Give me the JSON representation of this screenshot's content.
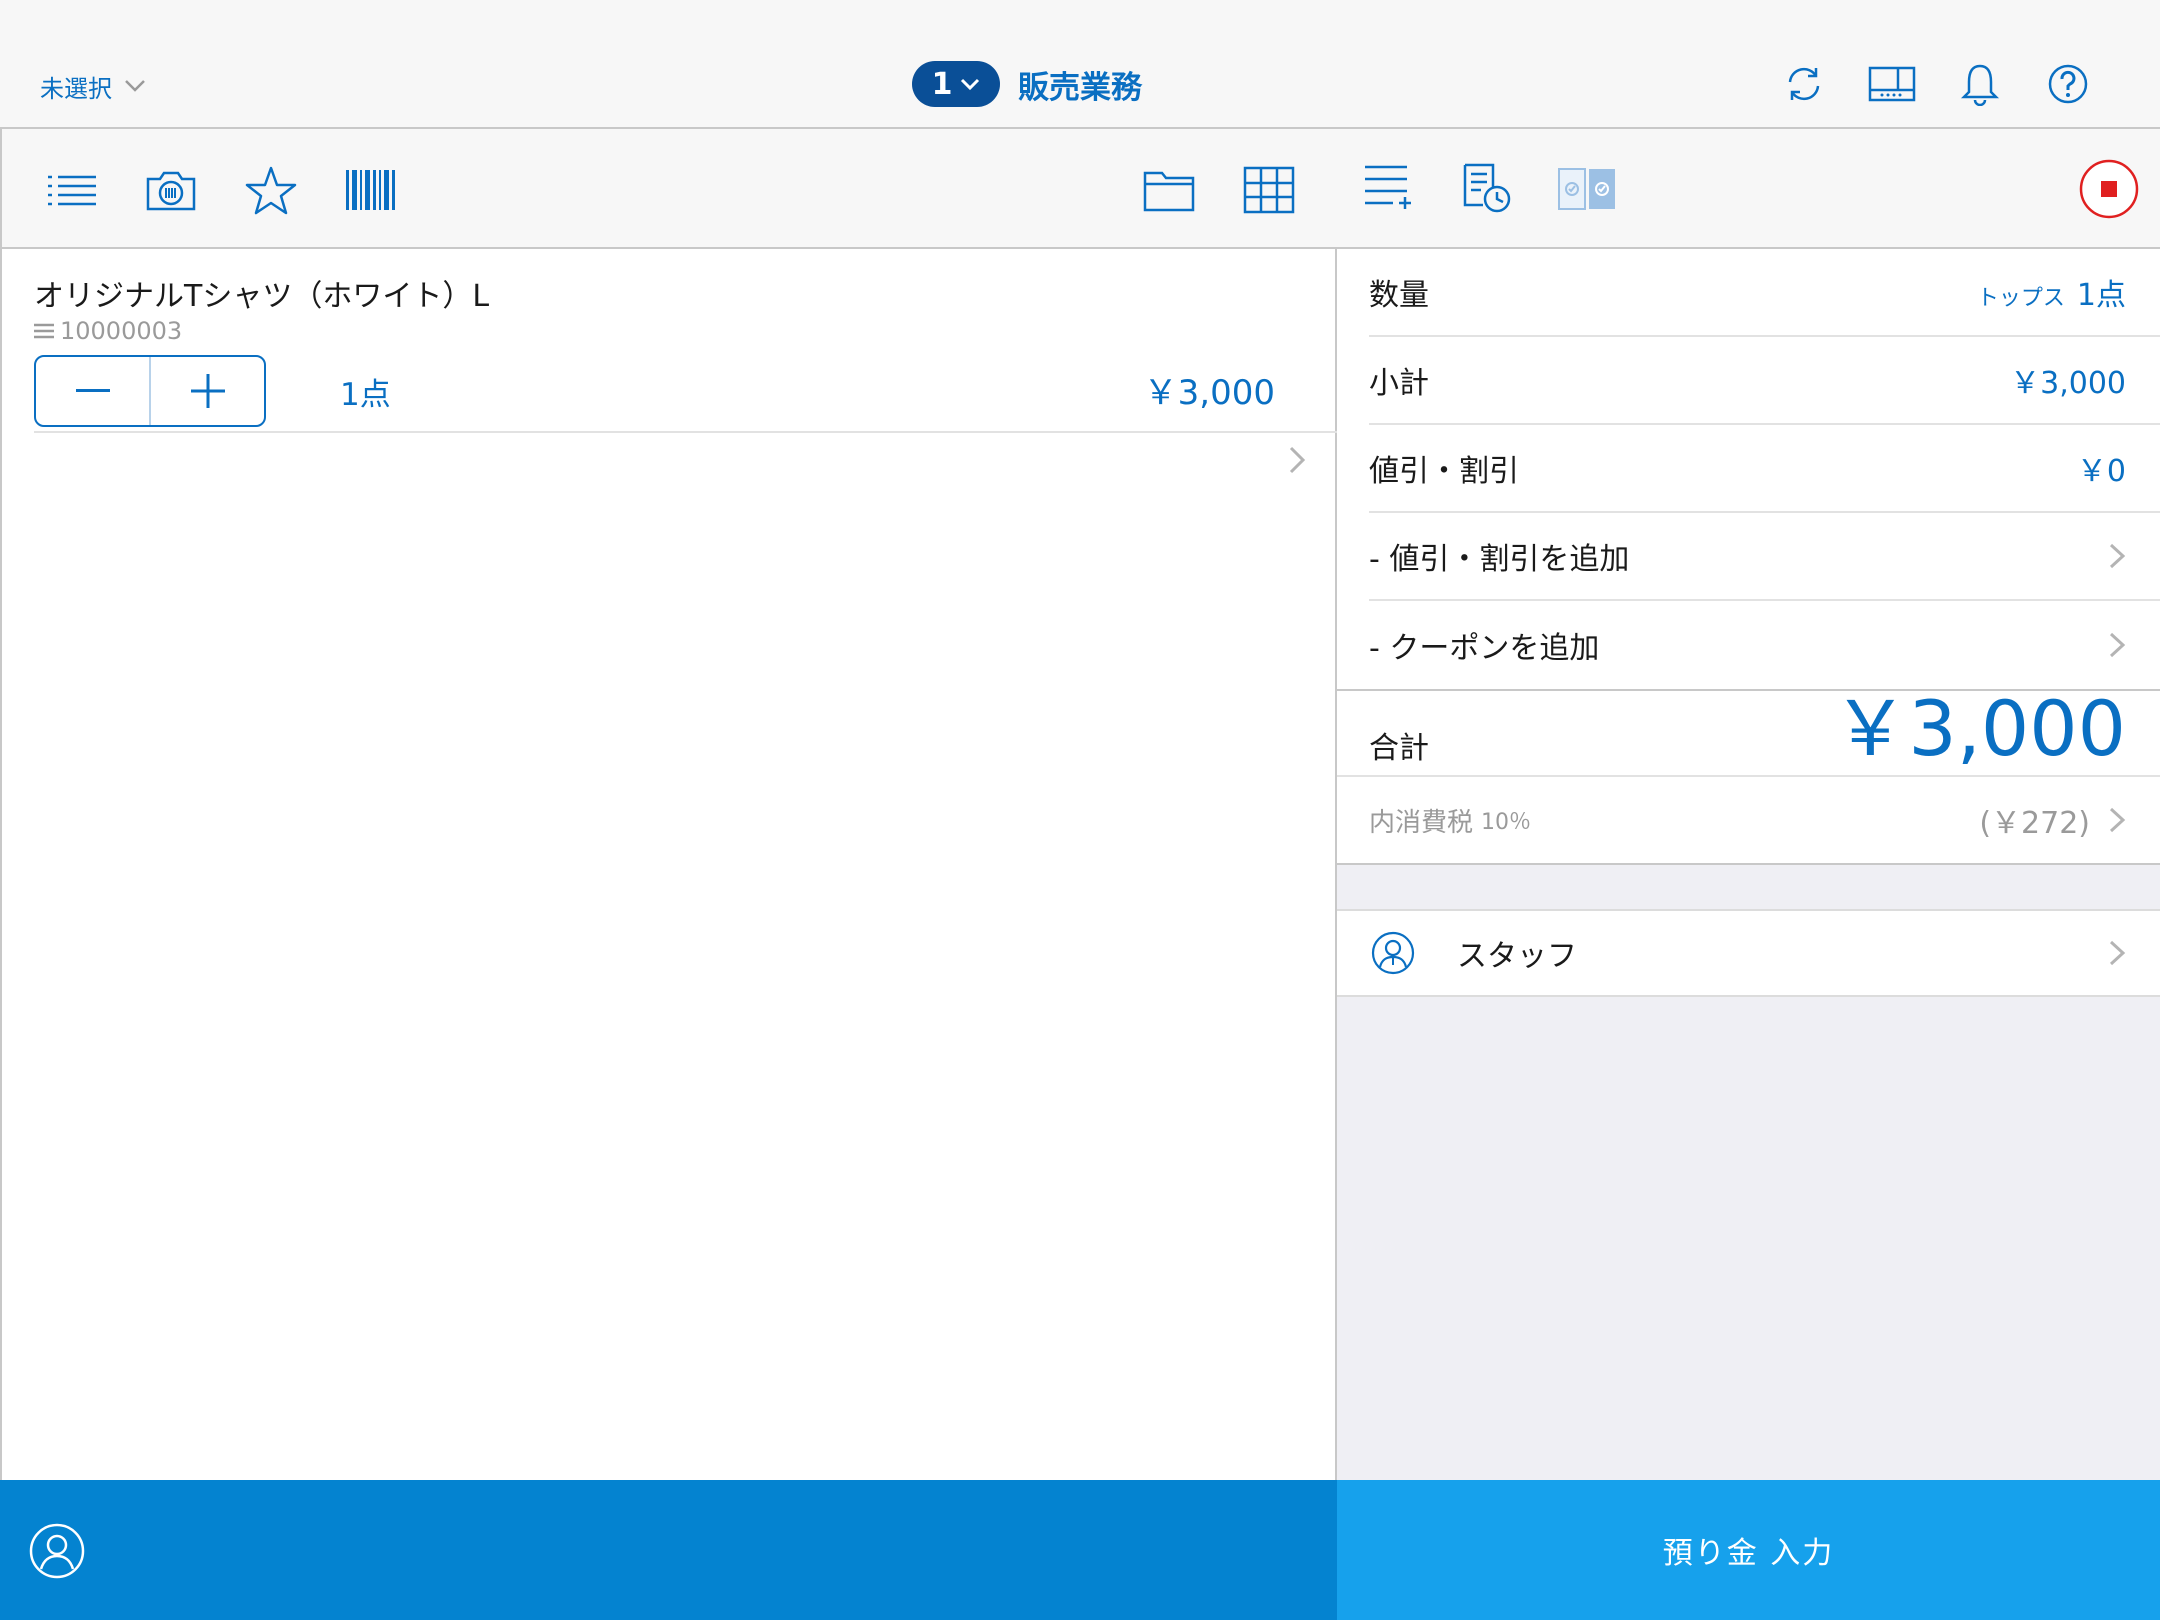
{
  "header": {
    "store_label": "未選択",
    "register_number": "1",
    "mode_title": "販売業務",
    "icons": [
      "sync-icon",
      "drawer-icon",
      "bell-icon",
      "help-icon"
    ]
  },
  "left_toolbar": {
    "icons": [
      "list-icon",
      "camera-icon",
      "star-icon",
      "barcode-icon",
      "folder-icon",
      "grid-icon"
    ]
  },
  "cart": {
    "items": [
      {
        "name": "オリジナルTシャツ（ホワイト）L",
        "code": "10000003",
        "quantity": "1点",
        "price": "￥3,000"
      }
    ]
  },
  "right_toolbar": {
    "icons": [
      "add-line-icon",
      "history-icon",
      "checkout-icon",
      "stop-icon"
    ]
  },
  "summary": {
    "quantity_label": "数量",
    "quantity_category": "トップス",
    "quantity_value": "1点",
    "subtotal_label": "小計",
    "subtotal_value": "￥3,000",
    "discount_label": "値引・割引",
    "discount_value": "￥0",
    "add_discount_label": "- 値引・割引を追加",
    "add_coupon_label": "- クーポンを追加",
    "total_label": "合計",
    "total_value": "￥3,000",
    "tax_label": "内消費税",
    "tax_rate": "10％",
    "tax_value": "(￥272)"
  },
  "staff": {
    "label": "スタッフ"
  },
  "footer": {
    "deposit_label": "預り金 入力"
  },
  "colors": {
    "accent": "#0a6fc2",
    "pill": "#0a4f97",
    "bottom_left": "#0483d0",
    "bottom_right": "#16a1ec",
    "stop_red": "#e02020"
  }
}
